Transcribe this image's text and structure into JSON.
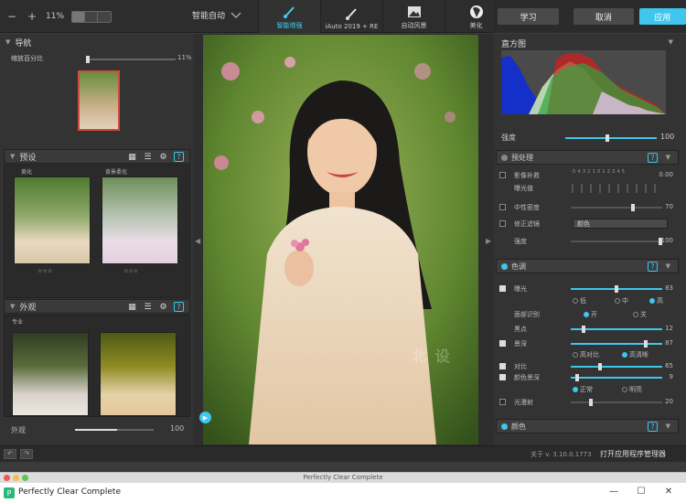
{
  "toolbar": {
    "zoom_out_icon": "minus-icon",
    "zoom_in_icon": "plus-icon",
    "zoom_level": "11%",
    "mode": "智能自动",
    "tabs": [
      {
        "label": "智能增强",
        "icon": "brush-2019-icon",
        "active": true
      },
      {
        "label": "iAuto 2019 + RE",
        "icon": "brush-2019-icon",
        "active": false
      },
      {
        "label": "自动风景",
        "icon": "landscape-icon",
        "active": false
      },
      {
        "label": "美化",
        "icon": "face-icon",
        "active": false
      }
    ],
    "learn_label": "学习",
    "cancel_label": "取消",
    "apply_label": "应用"
  },
  "navigator": {
    "title": "导航",
    "zoom_label": "缩放百分比",
    "zoom_value": "11%"
  },
  "presets": {
    "title": "预设",
    "items": [
      {
        "label": "美化"
      },
      {
        "label": "背景柔化"
      }
    ]
  },
  "looks": {
    "title": "外观",
    "partial_label": "专业",
    "strength_label": "外观",
    "strength_value": "100",
    "strength_level": 0.53
  },
  "histogram": {
    "title": "直方图",
    "strength_label": "强度",
    "strength_value": "100",
    "strength_level": 0.46
  },
  "pretreatment": {
    "title": "预处理",
    "rows": [
      {
        "label": "影像补救",
        "value": "0.00",
        "checked": false
      },
      {
        "label": "曝光值",
        "value": "",
        "checked": false
      },
      {
        "label": "中性密度",
        "value": "70",
        "checked": false
      },
      {
        "label": "修正滤镜",
        "value": "",
        "checked": false
      },
      {
        "label": "强度",
        "value": "100",
        "checked": false
      }
    ],
    "ticks": "-5 4 3 2 1 0 1 2 3 4 5",
    "filter_option": "颜色"
  },
  "tone": {
    "title": "色调",
    "exposure": {
      "label": "曝光",
      "value": "83",
      "level": 0.48
    },
    "exposure_modes": [
      "低",
      "中",
      "高"
    ],
    "face_detect_label": "面部识别",
    "face_detect_options": [
      "开",
      "关"
    ],
    "black_point": {
      "label": "黑点",
      "value": "12",
      "level": 0.12
    },
    "depth": {
      "label": "景深",
      "value": "87",
      "level": 0.82
    },
    "depth_modes": [
      "高对比",
      "高清晰"
    ],
    "contrast": {
      "label": "对比",
      "value": "65",
      "level": 0.3
    },
    "color_depth": {
      "label": "颜色景深",
      "value": "9",
      "level": 0.05
    },
    "color_depth_modes": [
      "正常",
      "明亮"
    ],
    "light_diffusion": {
      "label": "光漫射",
      "value": "20",
      "level": 0.2
    }
  },
  "color": {
    "title": "颜色"
  },
  "status": {
    "about": "关于 v. 3.10.0.1773",
    "open_manager": "打开应用程序管理器"
  },
  "window2": {
    "title": "Perfectly Clear Complete"
  },
  "window3": {
    "title": "Perfectly Clear Complete",
    "minimize": "—",
    "maximize": "☐",
    "close": "✕"
  },
  "colors": {
    "accent": "#3fc6ec",
    "panel": "#333333",
    "toolbar": "#2d2d2d",
    "apply": "#3fc6ec"
  }
}
